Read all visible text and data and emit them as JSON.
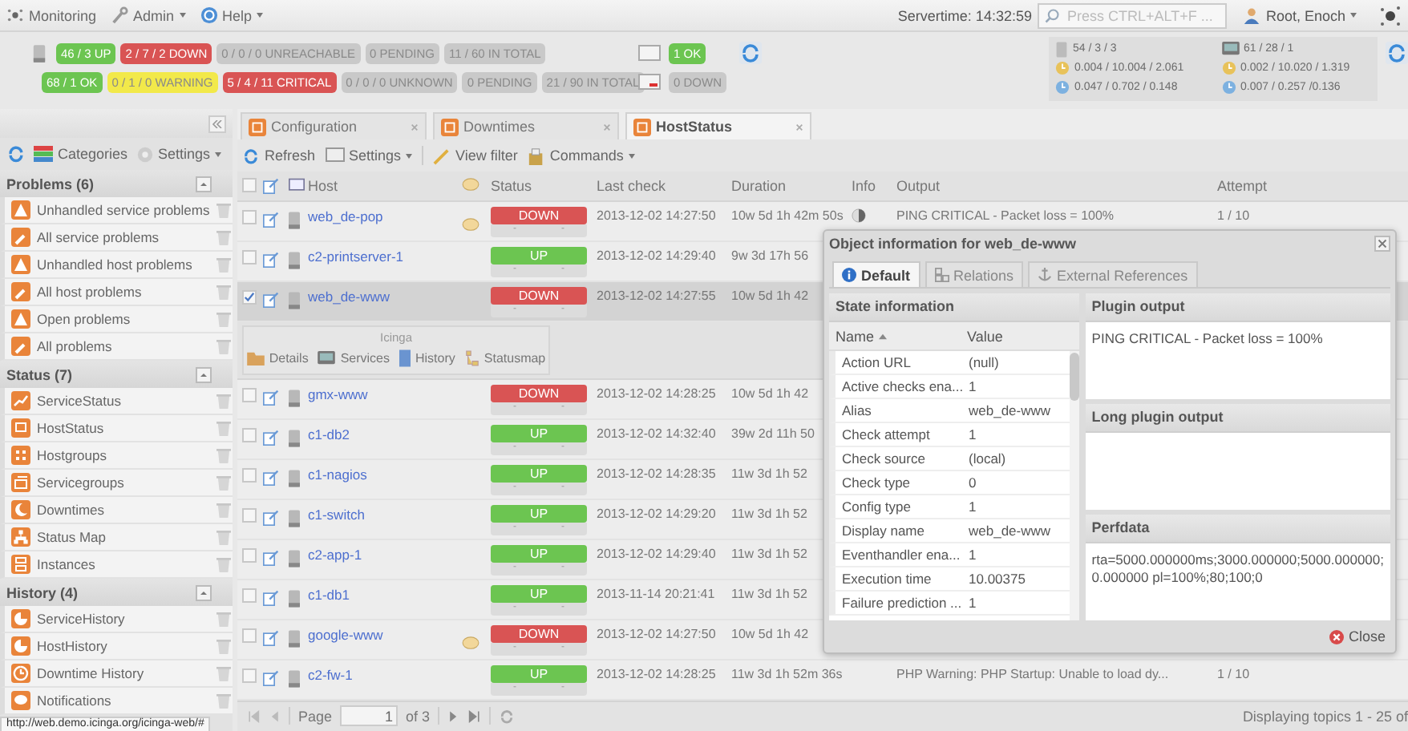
{
  "top_menu": {
    "items": [
      {
        "label": "Monitoring",
        "dropdown": false
      },
      {
        "label": "Admin",
        "dropdown": true
      },
      {
        "label": "Help",
        "dropdown": true
      }
    ],
    "servertime": "Servertime: 14:32:59",
    "search": {
      "placeholder": "Press CTRL+ALT+F ..."
    },
    "user": "Root, Enoch"
  },
  "status_summary": {
    "host_badges": [
      {
        "text": "46 / 3 UP",
        "color": "#6cc551"
      },
      {
        "text": "2 / 7 / 2 DOWN",
        "color": "#d95454"
      },
      {
        "text": "0 / 0 / 0 UNREACHABLE",
        "color": "#c9c9c9"
      },
      {
        "text": "0 PENDING",
        "color": "#c9c9c9"
      },
      {
        "text": "11 / 60 IN TOTAL",
        "color": "#c9c9c9"
      }
    ],
    "service_badges": [
      {
        "text": "68 / 1 OK",
        "color": "#6cc551"
      },
      {
        "text": "0 / 1 / 0 WARNING",
        "color": "#f2e94a"
      },
      {
        "text": "5 / 4 / 11 CRITICAL",
        "color": "#d95454"
      },
      {
        "text": "0 / 0 / 0 UNKNOWN",
        "color": "#c9c9c9"
      },
      {
        "text": "0 PENDING",
        "color": "#c9c9c9"
      },
      {
        "text": "21 / 90 IN TOTAL",
        "color": "#c9c9c9"
      }
    ],
    "extra_badges": [
      {
        "text": "1 OK",
        "color": "#6cc551"
      },
      {
        "text": "0 DOWN",
        "color": "#c9c9c9"
      }
    ]
  },
  "stats": {
    "hosts": [
      "54 / 3 / 3",
      "0.004 / 10.004 / 2.061",
      "0.047 / 0.702 / 0.148"
    ],
    "services": [
      "61 / 28 / 1",
      "0.002 / 10.020 / 1.319",
      "0.007 / 0.257 /0.136"
    ]
  },
  "sidebar": {
    "toolbar": [
      "Categories",
      "Settings"
    ],
    "sections": [
      {
        "title": "Problems (6)",
        "items": [
          "Unhandled service problems",
          "All service problems",
          "Unhandled host problems",
          "All host problems",
          "Open problems",
          "All problems"
        ]
      },
      {
        "title": "Status (7)",
        "items": [
          "ServiceStatus",
          "HostStatus",
          "Hostgroups",
          "Servicegroups",
          "Downtimes",
          "Status Map",
          "Instances"
        ]
      },
      {
        "title": "History (4)",
        "items": [
          "ServiceHistory",
          "HostHistory",
          "Downtime History",
          "Notifications"
        ]
      }
    ]
  },
  "tabs": [
    {
      "label": "Configuration",
      "selected": false
    },
    {
      "label": "Downtimes",
      "selected": false
    },
    {
      "label": "HostStatus",
      "selected": true
    }
  ],
  "toolbar": [
    {
      "label": "Refresh",
      "dropdown": false
    },
    {
      "label": "Settings",
      "dropdown": true
    },
    {
      "label": "View filter",
      "dropdown": false
    },
    {
      "label": "Commands",
      "dropdown": true
    }
  ],
  "table": {
    "all_selected": false,
    "columns": [
      "Host",
      "Status",
      "Last check",
      "Duration",
      "Info",
      "Output",
      "Attempt"
    ],
    "rows": [
      {
        "host": "web_de-pop",
        "selected": false,
        "comment": true,
        "status": "DOWN",
        "color": "#d95454",
        "flags": [
          "-",
          "-"
        ],
        "last_check": "2013-12-02 14:27:50",
        "duration": "10w 5d 1h 42m 50s",
        "info": true,
        "output": "PING CRITICAL - Packet loss = 100%",
        "attempt": "1 / 10"
      },
      {
        "host": "c2-printserver-1",
        "selected": false,
        "comment": false,
        "status": "UP",
        "color": "#6cc551",
        "flags": [
          "-",
          "-"
        ],
        "last_check": "2013-12-02 14:29:40",
        "duration": "9w 3d 17h 56"
      },
      {
        "host": "web_de-www",
        "selected": true,
        "comment": false,
        "status": "DOWN",
        "color": "#d95454",
        "flags": [
          "-",
          "-"
        ],
        "last_check": "2013-12-02 14:27:55",
        "duration": "10w 5d 1h 42",
        "expanded": true,
        "context": {
          "title": "Icinga",
          "actions": [
            "Details",
            "Services",
            "History",
            "Statusmap"
          ]
        }
      },
      {
        "host": "gmx-www",
        "selected": false,
        "comment": false,
        "status": "DOWN",
        "color": "#d95454",
        "flags": [
          "-",
          "-"
        ],
        "last_check": "2013-12-02 14:28:25",
        "duration": "10w 5d 1h 42"
      },
      {
        "host": "c1-db2",
        "selected": false,
        "comment": false,
        "status": "UP",
        "color": "#6cc551",
        "flags": [
          "-",
          "-"
        ],
        "last_check": "2013-12-02 14:32:40",
        "duration": "39w 2d 11h 50"
      },
      {
        "host": "c1-nagios",
        "selected": false,
        "comment": false,
        "status": "UP",
        "color": "#6cc551",
        "flags": [
          "-",
          "-"
        ],
        "last_check": "2013-12-02 14:28:35",
        "duration": "11w 3d 1h 52"
      },
      {
        "host": "c1-switch",
        "selected": false,
        "comment": false,
        "status": "UP",
        "color": "#6cc551",
        "flags": [
          "-",
          "-"
        ],
        "last_check": "2013-12-02 14:29:20",
        "duration": "11w 3d 1h 52"
      },
      {
        "host": "c2-app-1",
        "selected": false,
        "comment": false,
        "status": "UP",
        "color": "#6cc551",
        "flags": [
          "-",
          "-"
        ],
        "last_check": "2013-12-02 14:29:40",
        "duration": "11w 3d 1h 52"
      },
      {
        "host": "c1-db1",
        "selected": false,
        "comment": false,
        "status": "UP",
        "color": "#6cc551",
        "flags": [
          "-",
          "-"
        ],
        "last_check": "2013-11-14 20:21:41",
        "duration": "11w 3d 1h 52"
      },
      {
        "host": "google-www",
        "selected": false,
        "comment": true,
        "status": "DOWN",
        "color": "#d95454",
        "flags": [
          "-",
          "-"
        ],
        "last_check": "2013-12-02 14:27:50",
        "duration": "10w 5d 1h 42"
      },
      {
        "host": "c2-fw-1",
        "selected": false,
        "comment": false,
        "status": "UP",
        "color": "#6cc551",
        "flags": [
          "-",
          "-"
        ],
        "last_check": "2013-12-02 14:28:25",
        "duration": "11w 3d 1h 52m 36s",
        "output": "PHP Warning: PHP Startup: Unable to load dy...",
        "attempt": "1 / 10"
      }
    ]
  },
  "pager": {
    "label": "Page",
    "value": "1",
    "of": "of 3",
    "status": "Displaying topics 1 - 25 of"
  },
  "popup": {
    "title": "Object information for web_de-www",
    "tabs": [
      {
        "label": "Default",
        "selected": true
      },
      {
        "label": "Relations",
        "selected": false
      },
      {
        "label": "External References",
        "selected": false
      }
    ],
    "state_title": "State information",
    "columns": [
      "Name",
      "Value"
    ],
    "rows": [
      [
        "Action URL",
        "(null)"
      ],
      [
        "Active checks ena...",
        "1"
      ],
      [
        "Alias",
        "web_de-www"
      ],
      [
        "Check attempt",
        "1"
      ],
      [
        "Check source",
        "(local)"
      ],
      [
        "Check type",
        "0"
      ],
      [
        "Config type",
        "1"
      ],
      [
        "Display name",
        "web_de-www"
      ],
      [
        "Eventhandler ena...",
        "1"
      ],
      [
        "Execution time",
        "10.00375"
      ],
      [
        "Failure prediction ...",
        "1"
      ]
    ],
    "panels": [
      {
        "title": "Plugin output",
        "text": "PING CRITICAL - Packet loss = 100%"
      },
      {
        "title": "Long plugin output"
      },
      {
        "title": "Perfdata",
        "text": "rta=5000.000000ms;3000.000000;5000.000000; 0.000000 pl=100%;80;100;0"
      }
    ],
    "close": "Close"
  },
  "browser_status": "http://web.demo.icinga.org/icinga-web/#"
}
